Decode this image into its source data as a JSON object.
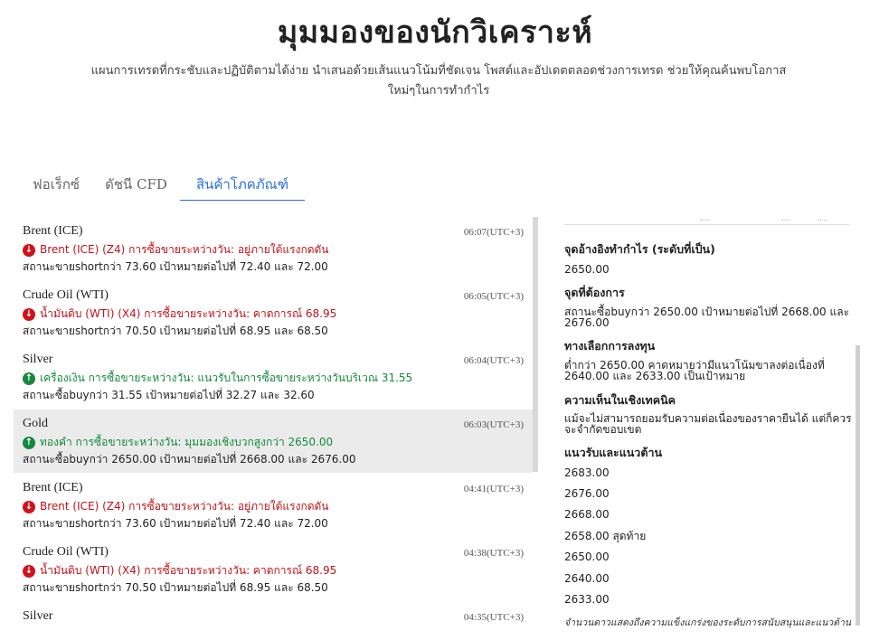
{
  "header": {
    "title": "มุมมองของนักวิเคราะห์",
    "subtitle": "แผนการเทรดที่กระชับและปฏิบัติตามได้ง่าย นำเสนอด้วยเส้นแนวโน้มที่ชัดเจน โพสต์และอัปเดตตลอดช่วงการเทรด ช่วยให้คุณค้นพบโอกาสใหม่ๆในการทำกำไร"
  },
  "tabs": [
    {
      "label": "ฟอเร็กซ์"
    },
    {
      "label": "ดัชนี CFD"
    },
    {
      "label": "สินค้าโภคภัณฑ์"
    }
  ],
  "list": [
    {
      "name": "Brent (ICE)",
      "time": "06:07(UTC+3)",
      "direction": "down",
      "signal": "Brent (ICE) (Z4) การซื้อขายระหว่างวัน: อยู่ภายใต้แรงกดดัน",
      "desc": "สถานะขายshortกว่า 73.60 เป้าหมายต่อไปที่ 72.40 และ 72.00"
    },
    {
      "name": "Crude Oil (WTI)",
      "time": "06:05(UTC+3)",
      "direction": "down",
      "signal": "น้ำมันดิบ (WTI) (X4) การซื้อขายระหว่างวัน: คาดการณ์ 68.95",
      "desc": "สถานะขายshortกว่า 70.50 เป้าหมายต่อไปที่ 68.95 และ 68.50"
    },
    {
      "name": "Silver",
      "time": "06:04(UTC+3)",
      "direction": "up",
      "signal": "เครื่องเงิน การซื้อขายระหว่างวัน: แนวรับในการซื้อขายระหว่างวันบริเวณ 31.55",
      "desc": "สถานะซื้อbuyกว่า 31.55 เป้าหมายต่อไปที่ 32.27 และ 32.60"
    },
    {
      "name": "Gold",
      "time": "06:03(UTC+3)",
      "direction": "up",
      "signal": "ทองคำ การซื้อขายระหว่างวัน: มุมมองเชิงบวกสูงกว่า 2650.00",
      "desc": "สถานะซื้อbuyกว่า 2650.00 เป้าหมายต่อไปที่ 2668.00 และ 2676.00"
    },
    {
      "name": "Brent (ICE)",
      "time": "04:41(UTC+3)",
      "direction": "down",
      "signal": "Brent (ICE) (Z4) การซื้อขายระหว่างวัน: อยู่ภายใต้แรงกดดัน",
      "desc": "สถานะขายshortกว่า 73.60 เป้าหมายต่อไปที่ 72.40 และ 72.00"
    },
    {
      "name": "Crude Oil (WTI)",
      "time": "04:38(UTC+3)",
      "direction": "down",
      "signal": "น้ำมันดิบ (WTI) (X4) การซื้อขายระหว่างวัน: คาดการณ์ 68.95",
      "desc": "สถานะขายshortกว่า 70.50 เป้าหมายต่อไปที่ 68.95 และ 68.50"
    },
    {
      "name": "Silver",
      "time": "04:35(UTC+3)",
      "direction": "up",
      "signal": "",
      "desc": ""
    }
  ],
  "detail": {
    "pivot_heading": "จุดอ้างอิงทำกำไร (ระดับที่เป็น)",
    "pivot_value": "2650.00",
    "preference_heading": "จุดที่ต้องการ",
    "preference_text": "สถานะซื้อbuyกว่า 2650.00 เป้าหมายต่อไปที่ 2668.00 และ 2676.00",
    "alternative_heading": "ทางเลือกการลงทุน",
    "alternative_text": "ต่ำกว่า 2650.00 คาดหมายว่ามีแนวโน้มขาลงต่อเนื่องที่ 2640.00 และ 2633.00 เป็นเป้าหมาย",
    "comment_heading": "ความเห็นในเชิงเทคนิค",
    "comment_text": "แม้จะไม่สามารถยอมรับความต่อเนื่องของราคายืนได้ แต่ก็ควรจะจำกัดขอบเขต",
    "levels_heading": "แนวรับและแนวต้าน",
    "levels": [
      "2683.00",
      "2676.00",
      "2668.00",
      "2658.00 สุดท้าย",
      "2650.00",
      "2640.00",
      "2633.00"
    ],
    "note": "จำนวนดาวแสดงถึงความแข็งแกร่งของระดับการสนับสนุนและแนวต้าน"
  },
  "colors": {
    "accent": "#2b6fd6",
    "down": "#d0121b",
    "up": "#16873e",
    "highlight": "#ebebeb"
  }
}
